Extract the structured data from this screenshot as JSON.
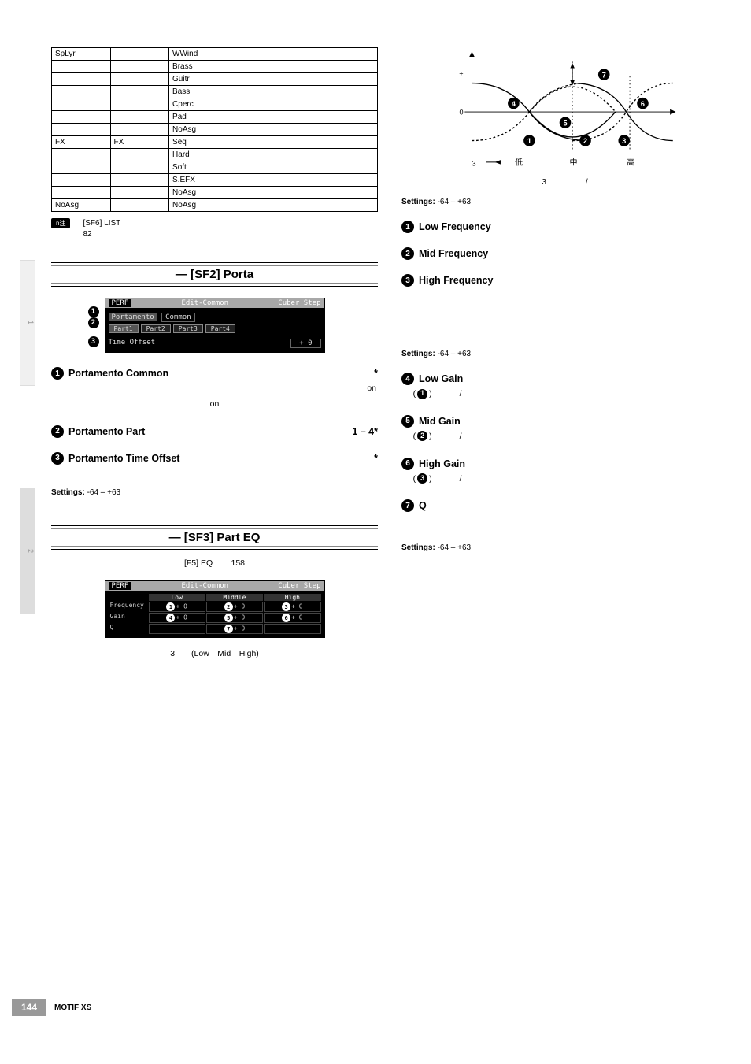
{
  "page_number": "144",
  "model": "MOTIF XS",
  "side_tabs": {
    "t1": "1",
    "t2": "2"
  },
  "table": {
    "rows": [
      {
        "c0": "SpLyr",
        "c1": "",
        "c2": "WWind",
        "c3": ""
      },
      {
        "c0": "",
        "c1": "",
        "c2": "Brass",
        "c3": ""
      },
      {
        "c0": "",
        "c1": "",
        "c2": "Guitr",
        "c3": ""
      },
      {
        "c0": "",
        "c1": "",
        "c2": "Bass",
        "c3": ""
      },
      {
        "c0": "",
        "c1": "",
        "c2": "Cperc",
        "c3": ""
      },
      {
        "c0": "",
        "c1": "",
        "c2": "Pad",
        "c3": ""
      },
      {
        "c0": "",
        "c1": "",
        "c2": "NoAsg",
        "c3": ""
      },
      {
        "c0": "FX",
        "c1": "FX",
        "c2": "Seq",
        "c3": ""
      },
      {
        "c0": "",
        "c1": "",
        "c2": "Hard",
        "c3": ""
      },
      {
        "c0": "",
        "c1": "",
        "c2": "Soft",
        "c3": ""
      },
      {
        "c0": "",
        "c1": "",
        "c2": "S.EFX",
        "c3": ""
      },
      {
        "c0": "",
        "c1": "",
        "c2": "NoAsg",
        "c3": ""
      },
      {
        "c0": "NoAsg",
        "c1": "",
        "c2": "NoAsg",
        "c3": ""
      }
    ]
  },
  "note": {
    "badge": "n注",
    "text_a": "[SF6] LIST",
    "text_b": "82"
  },
  "sf2": {
    "title": "— [SF2] Porta",
    "lcd": {
      "mode": "PERF",
      "title": "Edit-Common",
      "preset": "Cuber Step",
      "section": "Portamento",
      "common": "Common",
      "parts": [
        "Part1",
        "Part2",
        "Part3",
        "Part4"
      ],
      "row_label": "Time Offset",
      "row_value": "+ 0"
    },
    "params": [
      {
        "n": "1",
        "head": "Portamento Common",
        "after": "*",
        "body_a": "on",
        "body_b": "on"
      },
      {
        "n": "2",
        "head": "Portamento Part",
        "after": "1 – 4*",
        "body": ""
      },
      {
        "n": "3",
        "head": "Portamento Time Offset",
        "after": "*",
        "body": ""
      }
    ],
    "settings_label": "Settings:",
    "settings_value": "-64 – +63"
  },
  "sf3": {
    "title": "— [SF3] Part EQ",
    "desc_a": "[F5] EQ",
    "desc_b": "158",
    "lcd": {
      "mode": "PERF",
      "title": "Edit-Common",
      "preset": "Cuber Step",
      "cols": [
        "Low",
        "Middle",
        "High"
      ],
      "rows": [
        "Frequency",
        "Gain",
        "Q"
      ],
      "values": [
        [
          "+ 0",
          "+ 0",
          "+ 0"
        ],
        [
          "+ 0",
          "+ 0",
          "+ 0"
        ],
        [
          "",
          "+ 0",
          ""
        ]
      ]
    },
    "bands_label": "3　　(Low　Mid　High)"
  },
  "eq_diagram": {
    "y_plus": "+",
    "y_zero": "0",
    "x_label": "3",
    "x_low": "低",
    "x_mid": "中",
    "x_high": "高",
    "caption_a": "3",
    "caption_b": "/"
  },
  "right_settings": {
    "label": "Settings:",
    "value": "-64 – +63"
  },
  "right_params": [
    {
      "n": "1",
      "head": "Low Frequency"
    },
    {
      "n": "2",
      "head": "Mid Frequency"
    },
    {
      "n": "3",
      "head": "High Frequency"
    }
  ],
  "right_settings2": {
    "label": "Settings:",
    "value": "-64 – +63"
  },
  "gain_params": [
    {
      "n": "4",
      "head": "Low Gain",
      "ref": "1",
      "sep": "/"
    },
    {
      "n": "5",
      "head": "Mid Gain",
      "ref": "2",
      "sep": "/"
    },
    {
      "n": "6",
      "head": "High Gain",
      "ref": "3",
      "sep": "/"
    }
  ],
  "q_param": {
    "n": "7",
    "head": "Q"
  },
  "right_settings3": {
    "label": "Settings:",
    "value": "-64 – +63"
  }
}
